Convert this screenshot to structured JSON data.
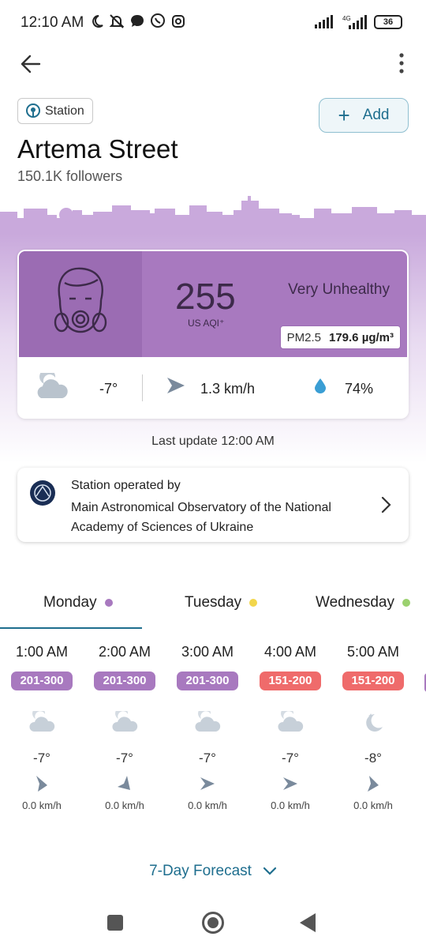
{
  "status_bar": {
    "time": "12:10 AM",
    "network": "4G",
    "battery": "36",
    "icons": [
      "moon-icon",
      "bell-off-icon",
      "messenger-icon",
      "viber-icon",
      "instagram-icon"
    ]
  },
  "header": {
    "back_icon": "arrow-left-icon",
    "more_icon": "more-vertical-icon",
    "station_chip": "Station",
    "add_label": "Add",
    "title": "Artema Street",
    "followers": "150.1K followers"
  },
  "aqi": {
    "value": "255",
    "unit": "US AQI⁺",
    "level": "Very Unhealthy",
    "pollutant": "PM2.5",
    "concentration": "179.6 µg/m³",
    "color": "#a879bf"
  },
  "weather": {
    "temperature": "-7°",
    "wind": "1.3 km/h",
    "humidity": "74%"
  },
  "last_update": "Last update 12:00 AM",
  "operator": {
    "label": "Station operated by",
    "name": "Main Astronomical Observatory of the National Academy of Sciences of Ukraine"
  },
  "tabs": [
    {
      "label": "Monday",
      "dot_color": "#a879bf",
      "active": true
    },
    {
      "label": "Tuesday",
      "dot_color": "#f2d64b",
      "active": false
    },
    {
      "label": "Wednesday",
      "dot_color": "#9bd16f",
      "active": false
    }
  ],
  "hourly": [
    {
      "time": "1:00 AM",
      "aqi_range": "201-300",
      "badge_color": "#a879bf",
      "temp": "-7°",
      "wind": "0.0 km/h",
      "weather_icon": "cloudy-night-icon"
    },
    {
      "time": "2:00 AM",
      "aqi_range": "201-300",
      "badge_color": "#a879bf",
      "temp": "-7°",
      "wind": "0.0 km/h",
      "weather_icon": "cloudy-night-icon"
    },
    {
      "time": "3:00 AM",
      "aqi_range": "201-300",
      "badge_color": "#a879bf",
      "temp": "-7°",
      "wind": "0.0 km/h",
      "weather_icon": "cloudy-night-icon"
    },
    {
      "time": "4:00 AM",
      "aqi_range": "151-200",
      "badge_color": "#ef6b6b",
      "temp": "-7°",
      "wind": "0.0 km/h",
      "weather_icon": "cloudy-night-icon"
    },
    {
      "time": "5:00 AM",
      "aqi_range": "151-200",
      "badge_color": "#ef6b6b",
      "temp": "-8°",
      "wind": "0.0 km/h",
      "weather_icon": "moon-icon"
    }
  ],
  "forecast_button": "7-Day Forecast"
}
